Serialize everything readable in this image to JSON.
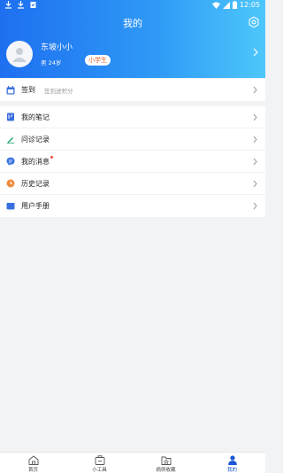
{
  "status_bar": {
    "time": "12:05"
  },
  "header": {
    "title": "我的"
  },
  "profile": {
    "name": "东坡小小",
    "gender_age": "男 24岁",
    "badge": "小学生"
  },
  "checkin": {
    "label": "签到",
    "subtitle": "签到送积分"
  },
  "menu": [
    {
      "label": "我的笔记",
      "icon": "notebook-icon"
    },
    {
      "label": "问诊记录",
      "icon": "pen-icon"
    },
    {
      "label": "我的消息",
      "icon": "message-icon",
      "has_dot": true
    },
    {
      "label": "历史记录",
      "icon": "clock-icon"
    },
    {
      "label": "用户手册",
      "icon": "book-icon"
    }
  ],
  "tabs": [
    {
      "label": "首页",
      "icon": "home-icon",
      "active": false
    },
    {
      "label": "小工具",
      "icon": "toolbox-icon",
      "active": false
    },
    {
      "label": "病例收藏",
      "icon": "folder-star-icon",
      "active": false
    },
    {
      "label": "我的",
      "icon": "person-icon",
      "active": true
    }
  ],
  "colors": {
    "accent": "#1a56d6",
    "header_start": "#1e6ff0",
    "header_end": "#4ec7fb",
    "badge_text": "#e56a35",
    "dot": "#f24a3b"
  }
}
